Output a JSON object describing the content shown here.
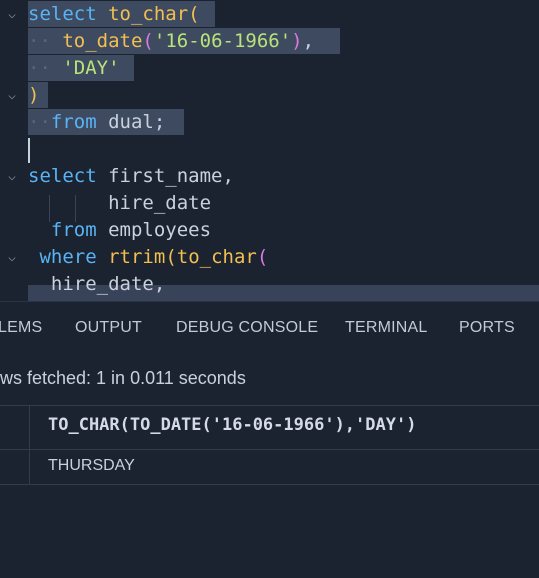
{
  "editor": {
    "lines": [
      {
        "fold": "⌵",
        "tokens": [
          [
            "kw",
            "select"
          ],
          [
            "pl",
            " "
          ],
          [
            "fn",
            "to_char"
          ],
          [
            "paren",
            "("
          ]
        ]
      },
      {
        "fold": "",
        "tokens": [
          [
            "ws",
            "··"
          ],
          [
            "pl",
            " "
          ],
          [
            "fn",
            "to_date"
          ],
          [
            "paren2",
            "("
          ],
          [
            "str",
            "'16-06-1966'"
          ],
          [
            "paren2",
            ")"
          ],
          [
            "pl",
            ","
          ]
        ]
      },
      {
        "fold": "",
        "tokens": [
          [
            "ws",
            "··"
          ],
          [
            "pl",
            " "
          ],
          [
            "str",
            "'DAY'"
          ]
        ]
      },
      {
        "fold": "⌵",
        "tokens": [
          [
            "paren",
            ")"
          ]
        ]
      },
      {
        "fold": "",
        "tokens": [
          [
            "ws",
            "··"
          ],
          [
            "kw",
            "from"
          ],
          [
            "pl",
            " dual;"
          ]
        ]
      },
      {
        "fold": "",
        "tokens": []
      },
      {
        "fold": "⌵",
        "tokens": [
          [
            "kw",
            "select"
          ],
          [
            "pl",
            " first_name,"
          ]
        ]
      },
      {
        "fold": "",
        "tokens": [
          [
            "pl",
            "       hire_date"
          ]
        ]
      },
      {
        "fold": "",
        "tokens": [
          [
            "pl",
            "  "
          ],
          [
            "kw",
            "from"
          ],
          [
            "pl",
            " employees"
          ]
        ]
      },
      {
        "fold": "⌵",
        "tokens": [
          [
            "pl",
            " "
          ],
          [
            "kw",
            "where"
          ],
          [
            "pl",
            " "
          ],
          [
            "fn",
            "rtrim"
          ],
          [
            "paren",
            "("
          ],
          [
            "fn",
            "to_char"
          ],
          [
            "paren2",
            "("
          ]
        ]
      },
      {
        "fold": "",
        "tokens": [
          [
            "pl",
            "  hire_date,"
          ]
        ]
      }
    ]
  },
  "panel": {
    "tabs": [
      "LEMS",
      "OUTPUT",
      "DEBUG CONSOLE",
      "TERMINAL",
      "PORTS"
    ],
    "status": "ws fetched: 1 in 0.011 seconds"
  },
  "results": {
    "columns": [
      "TO_CHAR(TO_DATE('16-06-1966'),'DAY')"
    ],
    "rows": [
      [
        "THURSDAY"
      ]
    ]
  }
}
